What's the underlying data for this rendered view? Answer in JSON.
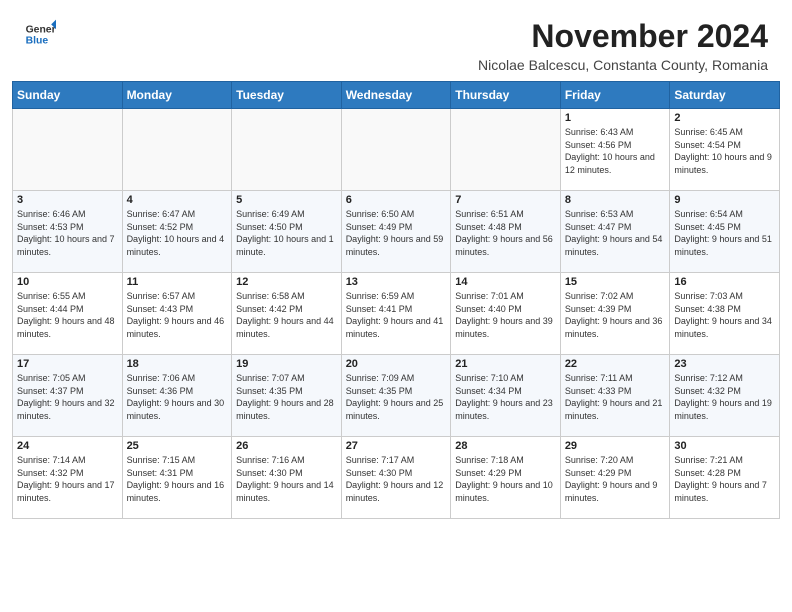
{
  "header": {
    "logo_general": "General",
    "logo_blue": "Blue",
    "month_title": "November 2024",
    "location": "Nicolae Balcescu, Constanta County, Romania"
  },
  "weekdays": [
    "Sunday",
    "Monday",
    "Tuesday",
    "Wednesday",
    "Thursday",
    "Friday",
    "Saturday"
  ],
  "weeks": [
    [
      {
        "day": "",
        "info": ""
      },
      {
        "day": "",
        "info": ""
      },
      {
        "day": "",
        "info": ""
      },
      {
        "day": "",
        "info": ""
      },
      {
        "day": "",
        "info": ""
      },
      {
        "day": "1",
        "info": "Sunrise: 6:43 AM\nSunset: 4:56 PM\nDaylight: 10 hours and 12 minutes."
      },
      {
        "day": "2",
        "info": "Sunrise: 6:45 AM\nSunset: 4:54 PM\nDaylight: 10 hours and 9 minutes."
      }
    ],
    [
      {
        "day": "3",
        "info": "Sunrise: 6:46 AM\nSunset: 4:53 PM\nDaylight: 10 hours and 7 minutes."
      },
      {
        "day": "4",
        "info": "Sunrise: 6:47 AM\nSunset: 4:52 PM\nDaylight: 10 hours and 4 minutes."
      },
      {
        "day": "5",
        "info": "Sunrise: 6:49 AM\nSunset: 4:50 PM\nDaylight: 10 hours and 1 minute."
      },
      {
        "day": "6",
        "info": "Sunrise: 6:50 AM\nSunset: 4:49 PM\nDaylight: 9 hours and 59 minutes."
      },
      {
        "day": "7",
        "info": "Sunrise: 6:51 AM\nSunset: 4:48 PM\nDaylight: 9 hours and 56 minutes."
      },
      {
        "day": "8",
        "info": "Sunrise: 6:53 AM\nSunset: 4:47 PM\nDaylight: 9 hours and 54 minutes."
      },
      {
        "day": "9",
        "info": "Sunrise: 6:54 AM\nSunset: 4:45 PM\nDaylight: 9 hours and 51 minutes."
      }
    ],
    [
      {
        "day": "10",
        "info": "Sunrise: 6:55 AM\nSunset: 4:44 PM\nDaylight: 9 hours and 48 minutes."
      },
      {
        "day": "11",
        "info": "Sunrise: 6:57 AM\nSunset: 4:43 PM\nDaylight: 9 hours and 46 minutes."
      },
      {
        "day": "12",
        "info": "Sunrise: 6:58 AM\nSunset: 4:42 PM\nDaylight: 9 hours and 44 minutes."
      },
      {
        "day": "13",
        "info": "Sunrise: 6:59 AM\nSunset: 4:41 PM\nDaylight: 9 hours and 41 minutes."
      },
      {
        "day": "14",
        "info": "Sunrise: 7:01 AM\nSunset: 4:40 PM\nDaylight: 9 hours and 39 minutes."
      },
      {
        "day": "15",
        "info": "Sunrise: 7:02 AM\nSunset: 4:39 PM\nDaylight: 9 hours and 36 minutes."
      },
      {
        "day": "16",
        "info": "Sunrise: 7:03 AM\nSunset: 4:38 PM\nDaylight: 9 hours and 34 minutes."
      }
    ],
    [
      {
        "day": "17",
        "info": "Sunrise: 7:05 AM\nSunset: 4:37 PM\nDaylight: 9 hours and 32 minutes."
      },
      {
        "day": "18",
        "info": "Sunrise: 7:06 AM\nSunset: 4:36 PM\nDaylight: 9 hours and 30 minutes."
      },
      {
        "day": "19",
        "info": "Sunrise: 7:07 AM\nSunset: 4:35 PM\nDaylight: 9 hours and 28 minutes."
      },
      {
        "day": "20",
        "info": "Sunrise: 7:09 AM\nSunset: 4:35 PM\nDaylight: 9 hours and 25 minutes."
      },
      {
        "day": "21",
        "info": "Sunrise: 7:10 AM\nSunset: 4:34 PM\nDaylight: 9 hours and 23 minutes."
      },
      {
        "day": "22",
        "info": "Sunrise: 7:11 AM\nSunset: 4:33 PM\nDaylight: 9 hours and 21 minutes."
      },
      {
        "day": "23",
        "info": "Sunrise: 7:12 AM\nSunset: 4:32 PM\nDaylight: 9 hours and 19 minutes."
      }
    ],
    [
      {
        "day": "24",
        "info": "Sunrise: 7:14 AM\nSunset: 4:32 PM\nDaylight: 9 hours and 17 minutes."
      },
      {
        "day": "25",
        "info": "Sunrise: 7:15 AM\nSunset: 4:31 PM\nDaylight: 9 hours and 16 minutes."
      },
      {
        "day": "26",
        "info": "Sunrise: 7:16 AM\nSunset: 4:30 PM\nDaylight: 9 hours and 14 minutes."
      },
      {
        "day": "27",
        "info": "Sunrise: 7:17 AM\nSunset: 4:30 PM\nDaylight: 9 hours and 12 minutes."
      },
      {
        "day": "28",
        "info": "Sunrise: 7:18 AM\nSunset: 4:29 PM\nDaylight: 9 hours and 10 minutes."
      },
      {
        "day": "29",
        "info": "Sunrise: 7:20 AM\nSunset: 4:29 PM\nDaylight: 9 hours and 9 minutes."
      },
      {
        "day": "30",
        "info": "Sunrise: 7:21 AM\nSunset: 4:28 PM\nDaylight: 9 hours and 7 minutes."
      }
    ]
  ]
}
